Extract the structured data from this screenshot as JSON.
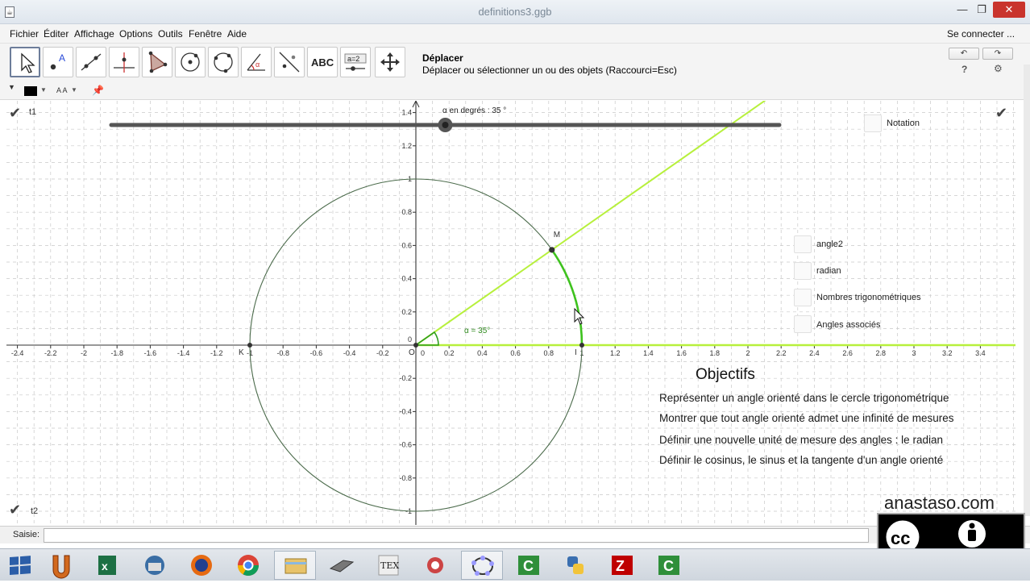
{
  "window": {
    "title": "definitions3.ggb",
    "app_icon_label": "☕"
  },
  "menu": [
    "Fichier",
    "Éditer",
    "Affichage",
    "Options",
    "Outils",
    "Fenêtre",
    "Aide"
  ],
  "login_label": "Se connecter ...",
  "toolbar": {
    "tools": [
      "move-tool",
      "point-tool",
      "line-tool",
      "perpendicular-tool",
      "polygon-tool",
      "circle-center-tool",
      "circle-three-points-tool",
      "angle-tool",
      "reflect-tool",
      "text-tool",
      "slider-tool",
      "move-graphics-tool"
    ],
    "text_tool_label": "ABC",
    "slider_tool_label": "a=2",
    "active_tool_name": "Déplacer",
    "active_tool_help": "Déplacer ou sélectionner un ou des objets (Raccourci=Esc)",
    "undo_icon": "undo-icon",
    "redo_icon": "redo-icon",
    "help_label": "?",
    "settings_icon": "gear-icon"
  },
  "stylebar": {
    "fontsize_label": "A A"
  },
  "graphics": {
    "panel_labels": {
      "top_left": "t1",
      "bottom_left": "t2"
    },
    "slider_label": "α en degrés : 35 °",
    "slider_value": 35,
    "point_M": "M",
    "point_K": "K",
    "point_I": "I",
    "origin_label": "O",
    "angle_label": "α = 35°",
    "x_ticks": [
      "-2.4",
      "-2.2",
      "-2",
      "-1.8",
      "-1.6",
      "-1.4",
      "-1.2",
      "-1",
      "-0.8",
      "-0.6",
      "-0.4",
      "-0.2",
      "0",
      "0.2",
      "0.4",
      "0.6",
      "0.8",
      "1",
      "1.2",
      "1.4",
      "1.6",
      "1.8",
      "2",
      "2.2",
      "2.4",
      "2.6",
      "2.8",
      "3",
      "3.2",
      "3.4"
    ],
    "y_ticks": [
      "1.4",
      "1.2",
      "1",
      "0.8",
      "0.6",
      "0.4",
      "0.2",
      "0",
      "-0.2",
      "-0.4",
      "-0.6",
      "-0.8",
      "-1"
    ],
    "checkboxes": [
      "Notation",
      "angle2",
      "radian",
      "Nombres trigonométriques",
      "Angles associés"
    ],
    "objectives_title": "Objectifs",
    "objectives": [
      "Représenter un angle orienté dans le cercle trigonométrique",
      "Montrer que tout angle orienté admet une infinité de mesures",
      "Définir une nouvelle unité de mesure des angles : le radian",
      "Définir le cosinus, le  sinus et la tangente d'un angle orienté"
    ],
    "colors": {
      "circle": "#4a6a4a",
      "ray": "#b7f03c",
      "arc": "#3ec21e",
      "angle": "#2f9e1e",
      "grid": "#c8c8c8"
    }
  },
  "input_label": "Saisie:",
  "watermark": {
    "site": "anastaso.com",
    "license_cc": "cc",
    "license_by": "BY"
  },
  "taskbar": [
    "windows-start-icon",
    "ultraedit-icon",
    "excel-icon",
    "thunderbird-icon",
    "firefox-icon",
    "chrome-icon",
    "file-explorer-icon",
    "sendto-icon",
    "tex-icon",
    "paint-icon",
    "geogebra-icon",
    "camtasia-icon",
    "python-icon",
    "filezilla-icon",
    "camtasia-recorder-icon"
  ]
}
